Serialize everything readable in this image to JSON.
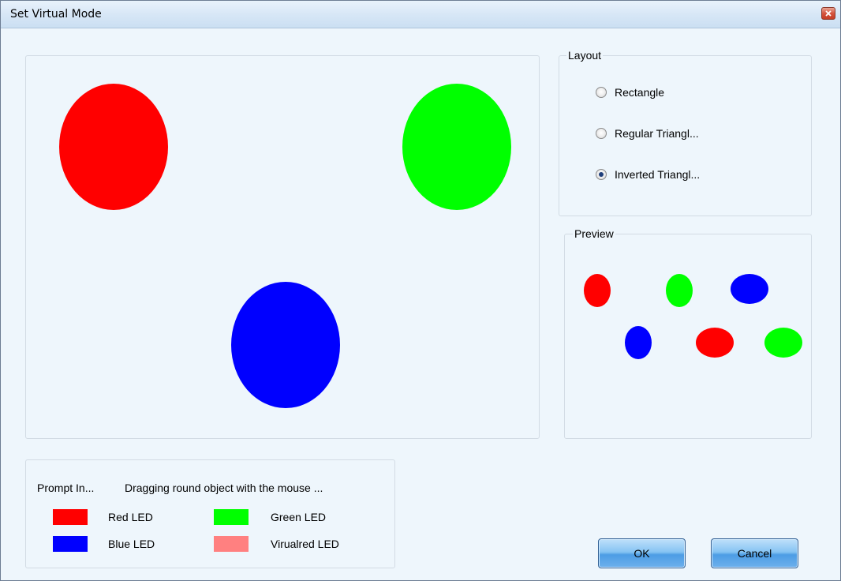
{
  "window": {
    "title": "Set Virtual Mode"
  },
  "colors": {
    "red": "#ff0000",
    "green": "#00ff00",
    "blue": "#0000ff",
    "virtual_red": "#ff8080",
    "window_bg": "#eef6fc"
  },
  "layout_group": {
    "label": "Layout",
    "options": [
      {
        "label": "Rectangle",
        "checked": false
      },
      {
        "label": "Regular Triangl...",
        "checked": false
      },
      {
        "label": "Inverted Triangl...",
        "checked": true
      }
    ]
  },
  "preview_group": {
    "label": "Preview"
  },
  "prompt": {
    "title": "Prompt In...",
    "message": "Dragging round object with the mouse ...",
    "legend": [
      {
        "label": "Red LED",
        "color": "#ff0000"
      },
      {
        "label": "Green LED",
        "color": "#00ff00"
      },
      {
        "label": "Blue LED",
        "color": "#0000ff"
      },
      {
        "label": "Virualred LED",
        "color": "#ff8080"
      }
    ]
  },
  "buttons": {
    "ok": "OK",
    "cancel": "Cancel"
  },
  "icons": {
    "close": "close-icon"
  }
}
